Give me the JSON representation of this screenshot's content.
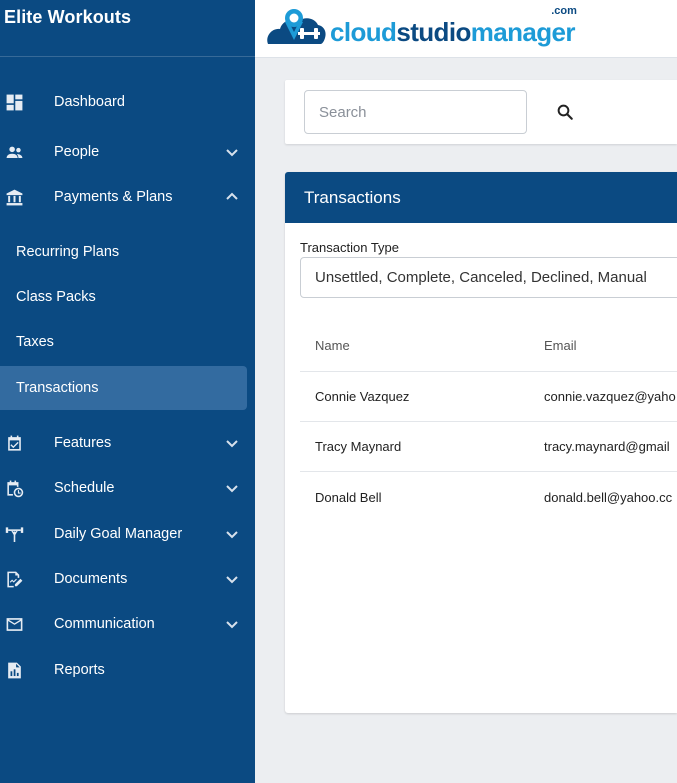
{
  "app": {
    "title": "Elite Workouts"
  },
  "logo": {
    "part1": "cloud",
    "part2": "studio",
    "part3": "manager",
    "suffix": ".com"
  },
  "sidebar": {
    "items": [
      {
        "label": "Dashboard",
        "icon": "dashboard-icon",
        "chevron": "none"
      },
      {
        "label": "People",
        "icon": "people-icon",
        "chevron": "down"
      },
      {
        "label": "Payments & Plans",
        "icon": "bank-icon",
        "chevron": "up"
      },
      {
        "label": "Features",
        "icon": "check-box-icon",
        "chevron": "down"
      },
      {
        "label": "Schedule",
        "icon": "calendar-clock-icon",
        "chevron": "down"
      },
      {
        "label": "Daily Goal Manager",
        "icon": "weightlifter-icon",
        "chevron": "down"
      },
      {
        "label": "Documents",
        "icon": "document-edit-icon",
        "chevron": "down"
      },
      {
        "label": "Communication",
        "icon": "mail-icon",
        "chevron": "down"
      },
      {
        "label": "Reports",
        "icon": "report-icon",
        "chevron": "none"
      }
    ],
    "payments_sub": [
      {
        "label": "Recurring Plans",
        "active": false
      },
      {
        "label": "Class Packs",
        "active": false
      },
      {
        "label": "Taxes",
        "active": false
      },
      {
        "label": "Transactions",
        "active": true
      }
    ]
  },
  "search": {
    "placeholder": "Search",
    "value": ""
  },
  "transactions": {
    "title": "Transactions",
    "type_label": "Transaction Type",
    "type_value": "Unsettled, Complete, Canceled, Declined, Manual",
    "columns": [
      "Name",
      "Email"
    ],
    "rows": [
      {
        "name": "Connie Vazquez",
        "email": "connie.vazquez@yaho"
      },
      {
        "name": "Tracy Maynard",
        "email": "tracy.maynard@gmail"
      },
      {
        "name": "Donald Bell",
        "email": "donald.bell@yahoo.cc"
      }
    ]
  },
  "colors": {
    "sidebar_bg": "#0b4a82",
    "active_item": "#336ba0",
    "brand_light": "#1d9bd7",
    "page_bg": "#eceef1"
  }
}
